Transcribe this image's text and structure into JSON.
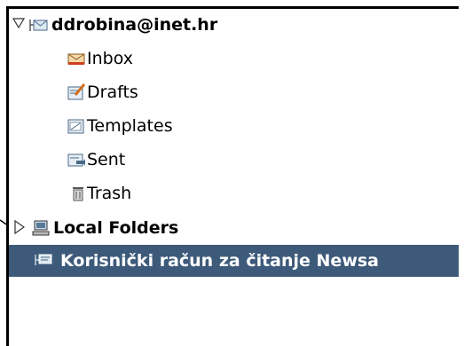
{
  "account": {
    "name": "ddrobina@inet.hr",
    "expanded": true,
    "folders": [
      {
        "label": "Inbox",
        "icon": "inbox-icon"
      },
      {
        "label": "Drafts",
        "icon": "drafts-icon"
      },
      {
        "label": "Templates",
        "icon": "templates-icon"
      },
      {
        "label": "Sent",
        "icon": "sent-icon"
      },
      {
        "label": "Trash",
        "icon": "trash-icon"
      }
    ]
  },
  "local_folders": {
    "label": "Local Folders",
    "expanded": false
  },
  "news_account": {
    "label": "Korisnički račun za čitanje Newsa",
    "selected": true
  },
  "colors": {
    "selection_bg": "#3d5a7a",
    "selection_text": "#ffffff"
  }
}
